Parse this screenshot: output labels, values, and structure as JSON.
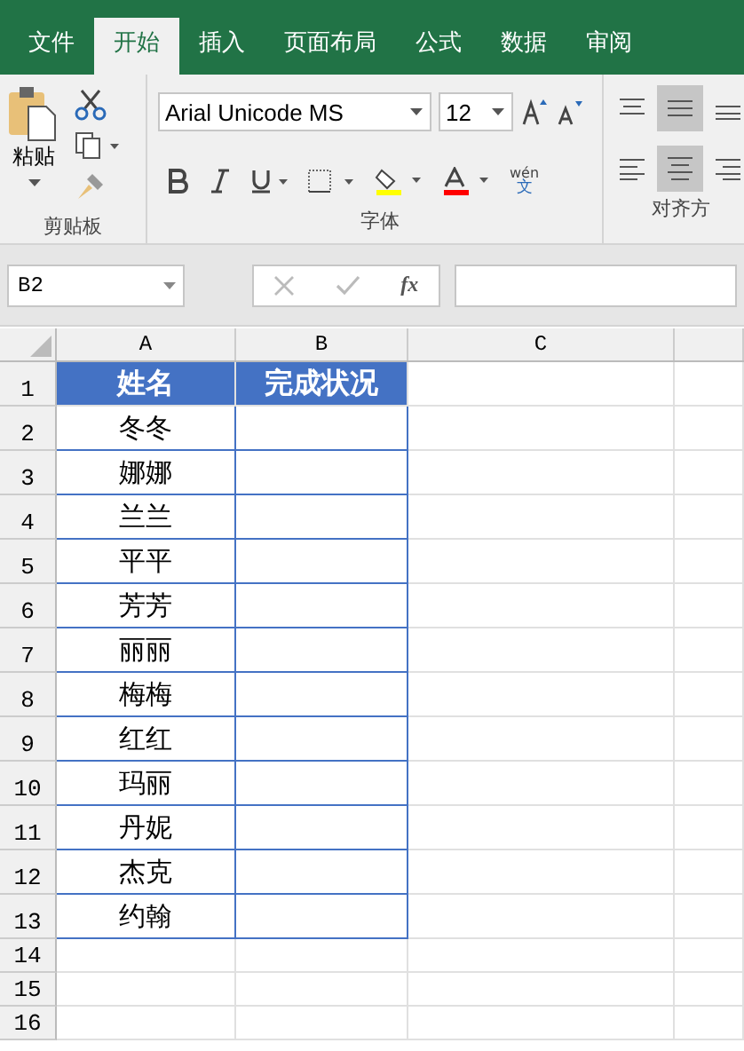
{
  "tabs": [
    {
      "label": "文件",
      "selected": false
    },
    {
      "label": "开始",
      "selected": true
    },
    {
      "label": "插入",
      "selected": false
    },
    {
      "label": "页面布局",
      "selected": false
    },
    {
      "label": "公式",
      "selected": false
    },
    {
      "label": "数据",
      "selected": false
    },
    {
      "label": "审阅",
      "selected": false
    }
  ],
  "ribbon": {
    "paste_label": "粘贴",
    "font_name": "Arial Unicode MS",
    "font_size": "12",
    "phonetic_label": "wén",
    "phonetic_char": "文",
    "groups": [
      "剪贴板",
      "字体",
      "对齐方"
    ]
  },
  "formula_bar": {
    "name_box": "B2",
    "fx": "fx"
  },
  "columns": [
    "A",
    "B",
    "C"
  ],
  "header_row": {
    "number": "1",
    "cells": [
      "姓名",
      "完成状况"
    ]
  },
  "rows": [
    {
      "number": "2",
      "cells": [
        "冬冬",
        ""
      ]
    },
    {
      "number": "3",
      "cells": [
        "娜娜",
        ""
      ]
    },
    {
      "number": "4",
      "cells": [
        "兰兰",
        ""
      ]
    },
    {
      "number": "5",
      "cells": [
        "平平",
        ""
      ]
    },
    {
      "number": "6",
      "cells": [
        "芳芳",
        ""
      ]
    },
    {
      "number": "7",
      "cells": [
        "丽丽",
        ""
      ]
    },
    {
      "number": "8",
      "cells": [
        "梅梅",
        ""
      ]
    },
    {
      "number": "9",
      "cells": [
        "红红",
        ""
      ]
    },
    {
      "number": "10",
      "cells": [
        "玛丽",
        ""
      ]
    },
    {
      "number": "11",
      "cells": [
        "丹妮",
        ""
      ]
    },
    {
      "number": "12",
      "cells": [
        "杰克",
        ""
      ]
    },
    {
      "number": "13",
      "cells": [
        "约翰",
        ""
      ]
    }
  ],
  "empty_rows": [
    "14",
    "15",
    "16"
  ]
}
